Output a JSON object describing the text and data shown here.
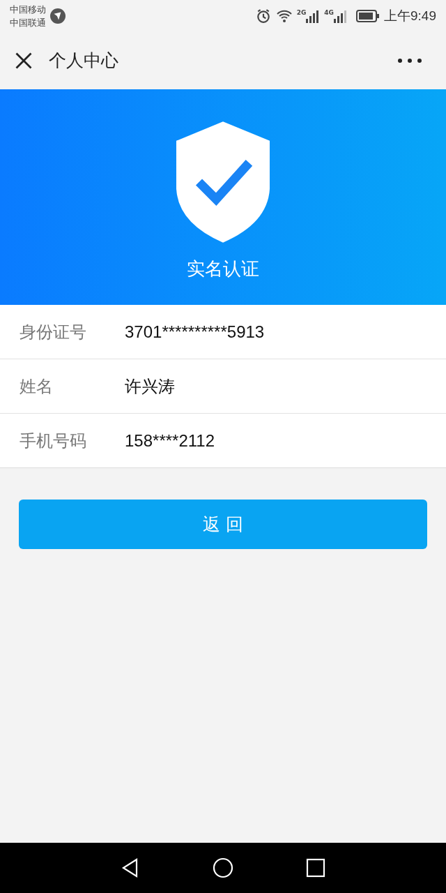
{
  "status_bar": {
    "carriers": [
      "中国移动",
      "中国联通"
    ],
    "signals": [
      {
        "label": "2G",
        "level": 1
      },
      {
        "label": "4G",
        "level": 0.75
      }
    ],
    "time": "上午9:49"
  },
  "nav": {
    "title": "个人中心"
  },
  "banner": {
    "title": "实名认证"
  },
  "fields": [
    {
      "label": "身份证号",
      "value": "3701**********5913"
    },
    {
      "label": "姓名",
      "value": "许兴涛"
    },
    {
      "label": "手机号码",
      "value": "158****2112"
    }
  ],
  "button": {
    "label": "返 回"
  }
}
